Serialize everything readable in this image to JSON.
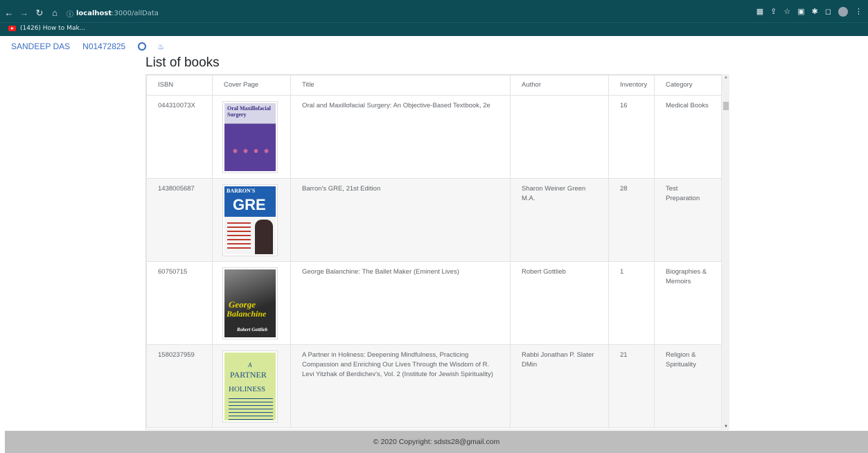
{
  "browser": {
    "url_host": "localhost",
    "url_path": ":3000/allData",
    "bookmark_label": "(1426) How to Mak..."
  },
  "nav": {
    "name": "SANDEEP DAS",
    "id": "N01472825"
  },
  "page": {
    "title": "List of books"
  },
  "table": {
    "headers": [
      "ISBN",
      "Cover Page",
      "Title",
      "Author",
      "Inventory",
      "Category"
    ],
    "rows": [
      {
        "isbn": "044310073X",
        "title": "Oral and Maxillofacial Surgery: An Objective-Based Textbook, 2e",
        "author": "",
        "inventory": "16",
        "category": "Medical Books",
        "cover": {
          "line1": "Oral",
          "line2": "Maxillofacial",
          "line3": "Surgery",
          "bg": "#5a3f9a",
          "accent": "#2d6fb8"
        }
      },
      {
        "isbn": "1438005687",
        "title": "Barron's GRE, 21st Edition",
        "author": "Sharon Weiner Green M.A.",
        "inventory": "28",
        "category": "Test Preparation",
        "cover": {
          "line1": "BARRON'S",
          "line2": "GRE",
          "bg": "#1f5fb0",
          "accent": "#f2c500"
        }
      },
      {
        "isbn": "60750715",
        "title": "George Balanchine: The Ballet Maker (Eminent Lives)",
        "author": "Robert Gottlieb",
        "inventory": "1",
        "category": "Biographies & Memoirs",
        "cover": {
          "line1": "George",
          "line2": "Balanchine",
          "line3": "Robert Gottlieb",
          "bg": "#3a3a3a",
          "accent": "#e2d400"
        }
      },
      {
        "isbn": "1580237959",
        "title": "A Partner in Holiness: Deepening Mindfulness, Practicing Compassion and Enriching Our Lives Through the Wisdom of R. Levi Yitzhak of Berdichev's, Vol. 2 (Institute for Jewish Spirituality)",
        "author": "Rabbi Jonathan P. Slater DMin",
        "inventory": "21",
        "category": "Religion & Spirituality",
        "cover": {
          "line1": "A",
          "line2": "PARTNER",
          "line3": "HOLINESS",
          "bg": "#d8e89a",
          "accent": "#1c4d8a"
        }
      }
    ]
  },
  "footer": {
    "text": "© 2020 Copyright: sdsts28@gmail.com"
  }
}
